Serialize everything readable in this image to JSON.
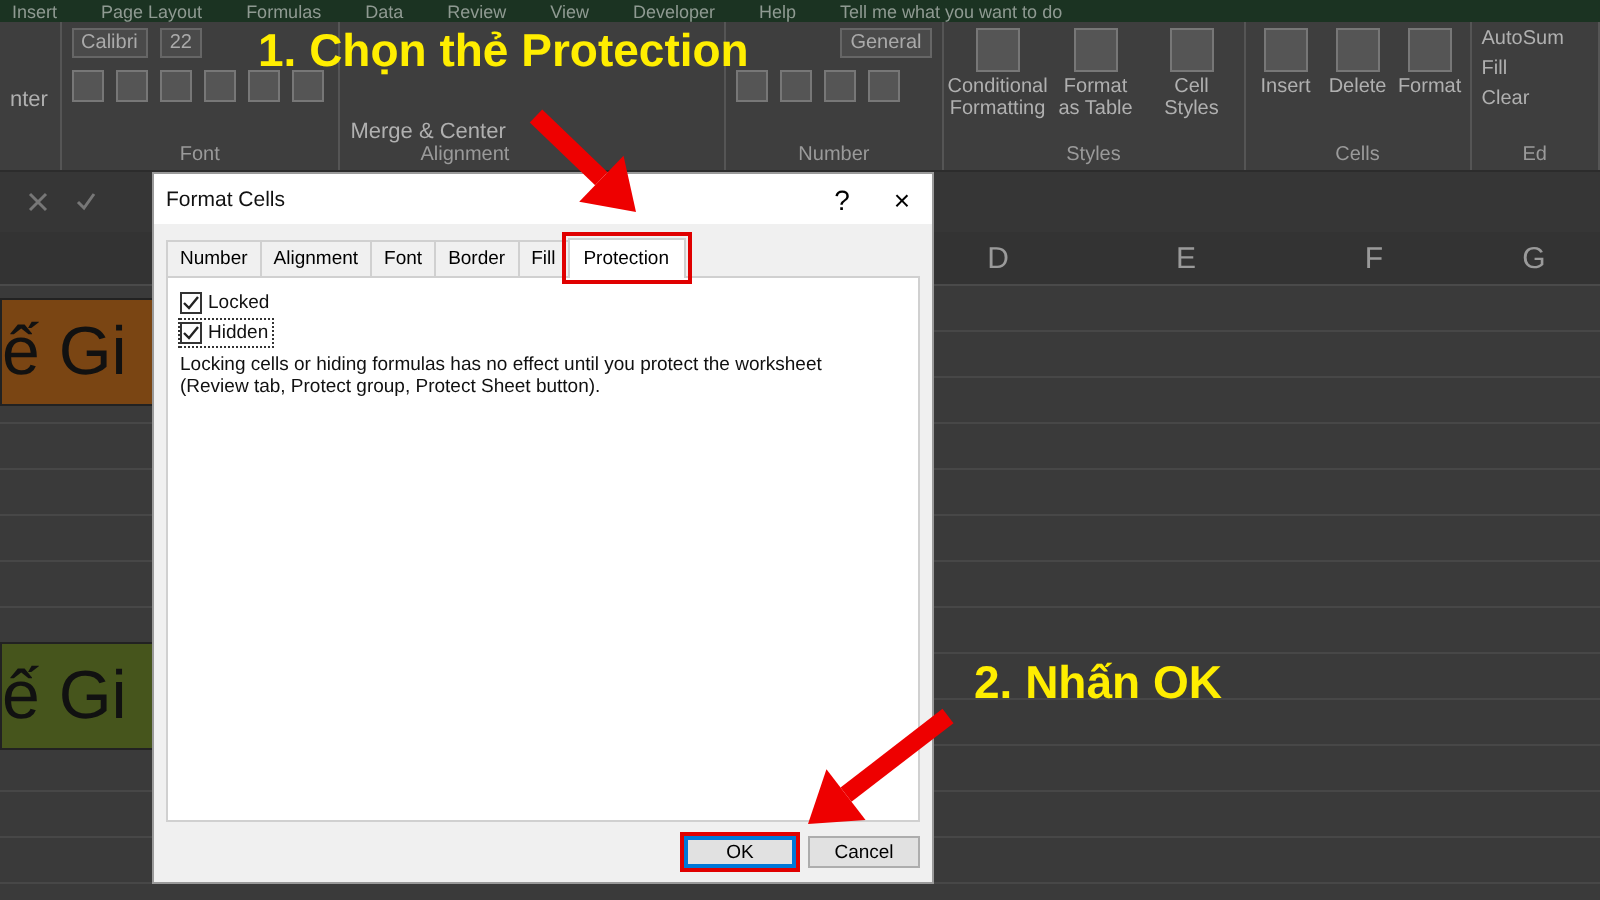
{
  "menu_tabs": [
    "Insert",
    "Page Layout",
    "Formulas",
    "Data",
    "Review",
    "View",
    "Developer",
    "Help"
  ],
  "tell_me": "Tell me what you want to do",
  "ribbon": {
    "cut_label": "nter",
    "font_name": "Calibri",
    "font_size": "22",
    "merge": "Merge & Center",
    "number_format": "General",
    "styles": [
      "Conditional Formatting",
      "Format as Table",
      "Cell Styles"
    ],
    "cells": [
      "Insert",
      "Delete",
      "Format"
    ],
    "editing": [
      "AutoSum",
      "Fill",
      "Clear"
    ],
    "groups": [
      "Font",
      "Alignment",
      "Number",
      "Styles",
      "Cells",
      "Ed"
    ]
  },
  "columns": [
    "D",
    "E",
    "F",
    "G"
  ],
  "cells": [
    {
      "text": "ế Gi",
      "color": "#7a4513"
    },
    {
      "text": "ế Gi",
      "color": "#46551c"
    }
  ],
  "dialog": {
    "title": "Format Cells",
    "help": "?",
    "close": "×",
    "tabs": [
      {
        "label": "Number",
        "selected": false,
        "highlighted": false
      },
      {
        "label": "Alignment",
        "selected": false,
        "highlighted": false
      },
      {
        "label": "Font",
        "selected": false,
        "highlighted": false
      },
      {
        "label": "Border",
        "selected": false,
        "highlighted": false
      },
      {
        "label": "Fill",
        "selected": false,
        "highlighted": false
      },
      {
        "label": "Protection",
        "selected": true,
        "highlighted": true
      }
    ],
    "options": [
      {
        "label": "Locked",
        "checked": true,
        "focused": false
      },
      {
        "label": "Hidden",
        "checked": true,
        "focused": true
      }
    ],
    "note": "Locking cells or hiding formulas has no effect until you protect the worksheet (Review tab, Protect group, Protect Sheet button).",
    "buttons": [
      {
        "label": "OK",
        "default": true,
        "highlighted": true
      },
      {
        "label": "Cancel",
        "default": false,
        "highlighted": false
      }
    ]
  },
  "steps": [
    "1. Chọn thẻ Protection",
    "2. Nhấn OK"
  ]
}
